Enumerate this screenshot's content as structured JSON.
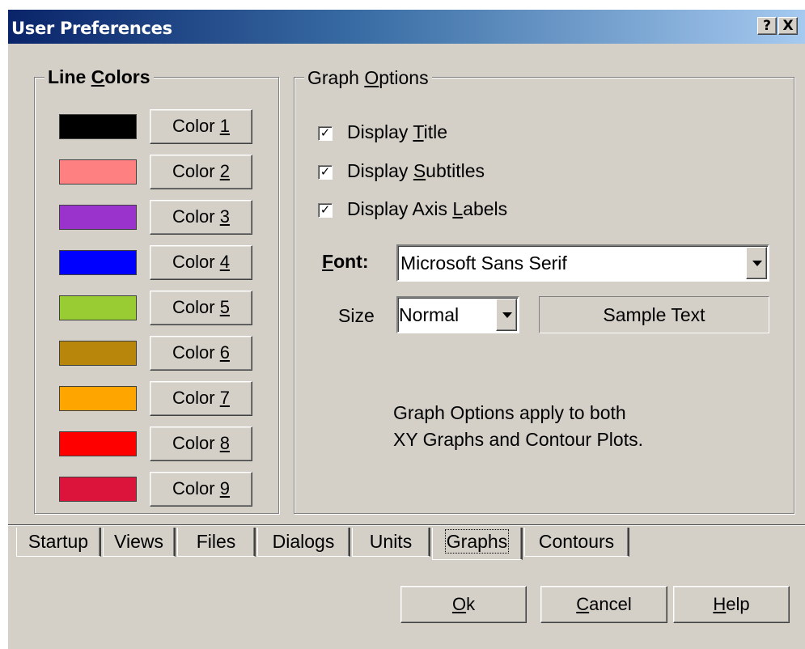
{
  "window": {
    "title": "User Preferences",
    "help_button": "?",
    "close_button": "X"
  },
  "line_colors": {
    "title_prefix": "Line ",
    "title_accel": "C",
    "title_rest": "olors",
    "items": [
      {
        "label": "Color ",
        "accel": "1",
        "color": "#000000"
      },
      {
        "label": "Color ",
        "accel": "2",
        "color": "#ff8080"
      },
      {
        "label": "Color ",
        "accel": "3",
        "color": "#9933cc"
      },
      {
        "label": "Color ",
        "accel": "4",
        "color": "#0000ff"
      },
      {
        "label": "Color ",
        "accel": "5",
        "color": "#99cc33"
      },
      {
        "label": "Color ",
        "accel": "6",
        "color": "#b8860b"
      },
      {
        "label": "Color ",
        "accel": "7",
        "color": "#ffa500"
      },
      {
        "label": "Color ",
        "accel": "8",
        "color": "#ff0000"
      },
      {
        "label": "Color ",
        "accel": "9",
        "color": "#dc143c"
      }
    ]
  },
  "graph_options": {
    "title_prefix": "Graph ",
    "title_accel": "O",
    "title_rest": "ptions",
    "checkboxes": [
      {
        "pre": "Display ",
        "accel": "T",
        "post": "itle",
        "checked": true
      },
      {
        "pre": "Display ",
        "accel": "S",
        "post": "ubtitles",
        "checked": true
      },
      {
        "pre": "Display Axis ",
        "accel": "L",
        "post": "abels",
        "checked": true
      }
    ],
    "font_label_accel": "F",
    "font_label_rest": "ont:",
    "font_value": "Microsoft Sans Serif",
    "size_label": "Size",
    "size_value": "Normal",
    "sample_text": "Sample Text",
    "note_line1": "Graph Options apply to both",
    "note_line2": "XY Graphs and Contour Plots."
  },
  "tabs": [
    "Startup",
    "Views",
    "Files",
    "Dialogs",
    "Units",
    "Graphs",
    "Contours"
  ],
  "active_tab": "Graphs",
  "buttons": {
    "ok_accel": "O",
    "ok_rest": "k",
    "cancel_accel": "C",
    "cancel_rest": "ancel",
    "help_accel": "H",
    "help_rest": "elp"
  }
}
